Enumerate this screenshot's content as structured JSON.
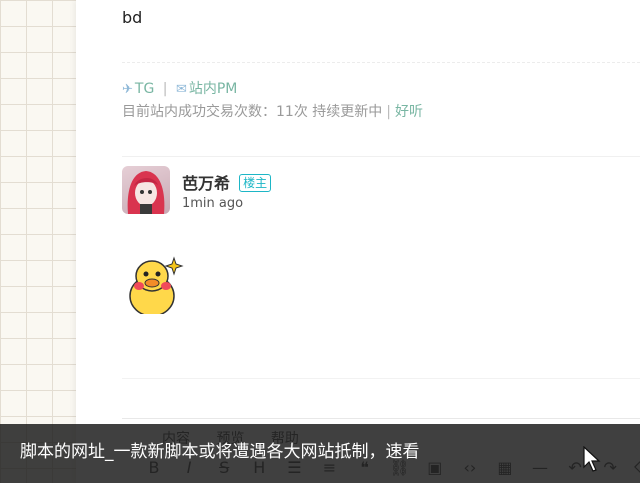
{
  "post": {
    "text": "bd"
  },
  "signature": {
    "tg_label": "TG",
    "separator": "|",
    "pm_label": "站内PM",
    "line2_text": "目前站内成功交易次数：11次 持续更新中",
    "line2_link": "好听"
  },
  "comment": {
    "author": "芭万希",
    "badge": "楼主",
    "time": "1min ago"
  },
  "editor": {
    "tabs": [
      "内容",
      "预览",
      "帮助"
    ],
    "toolbar_icons": [
      "bold-icon",
      "italic-icon",
      "strikethrough-icon",
      "heading-icon",
      "bullet-list-icon",
      "numbered-list-icon",
      "quote-icon",
      "link-icon",
      "image-icon",
      "code-icon",
      "table-icon",
      "horizontal-rule-icon",
      "undo-icon",
      "redo-icon",
      "eraser-icon"
    ]
  },
  "caption": {
    "text": "脚本的网址_一款新脚本或将遭遇各大网站抵制，速看"
  },
  "colors": {
    "link": "#79b6a3",
    "badge": "#1db6c6",
    "caption_bg": "#161616"
  }
}
